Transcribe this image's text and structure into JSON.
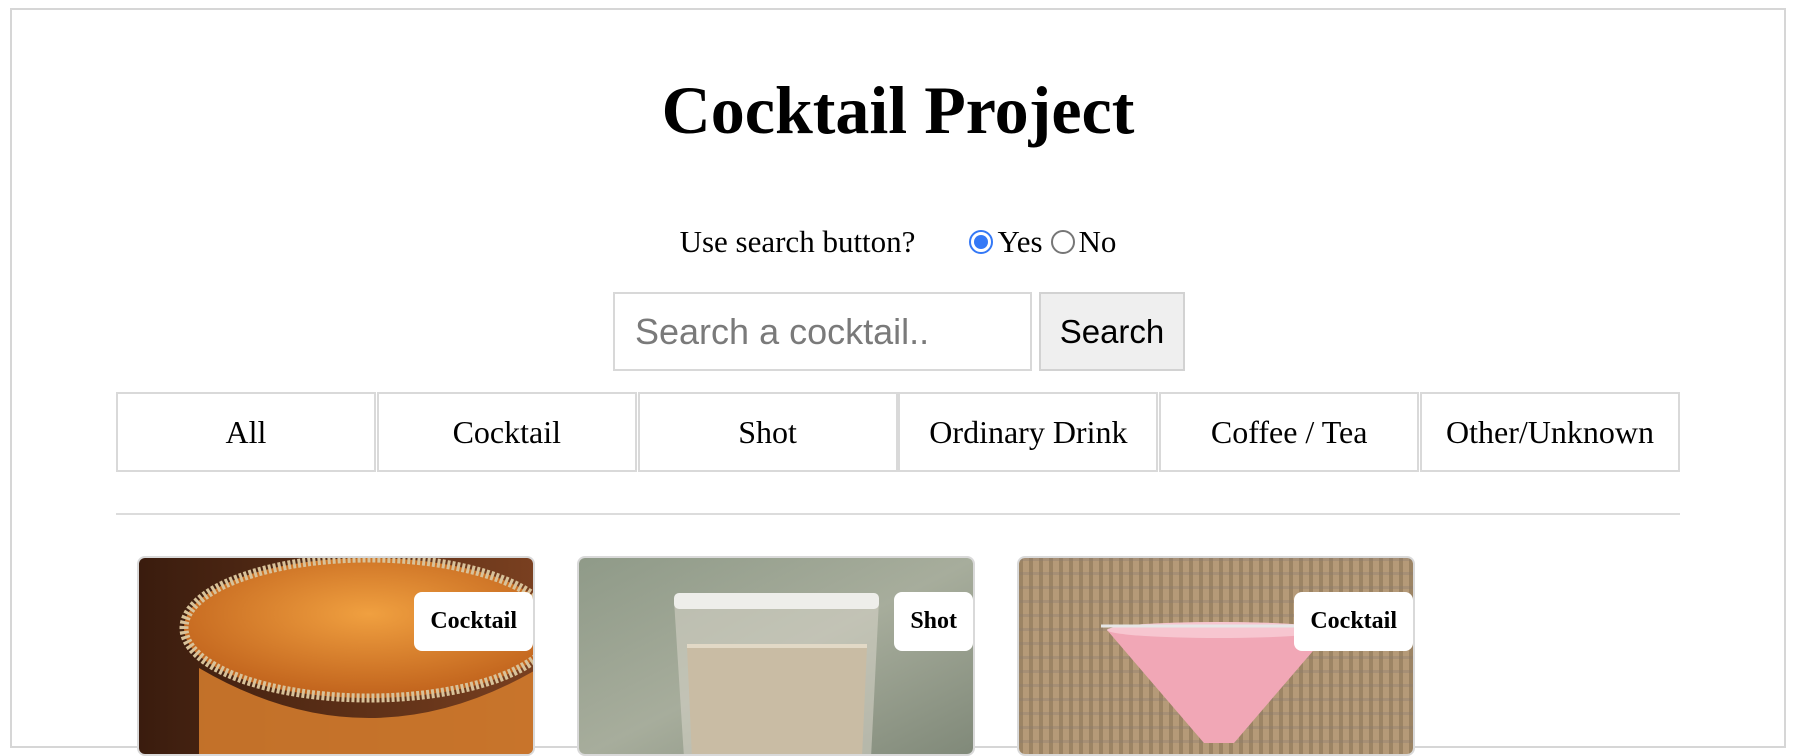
{
  "header": {
    "title": "Cocktail Project"
  },
  "search_mode": {
    "question": "Use search button?",
    "options": [
      {
        "label": "Yes",
        "checked": true
      },
      {
        "label": "No",
        "checked": false
      }
    ]
  },
  "search": {
    "placeholder": "Search a cocktail..",
    "value": "",
    "clear_icon": "close-icon",
    "button_label": "Search"
  },
  "categories": [
    "All",
    "Cocktail",
    "Shot",
    "Ordinary Drink",
    "Coffee / Tea",
    "Other/Unknown"
  ],
  "cards": [
    {
      "badge": "Cocktail"
    },
    {
      "badge": "Shot"
    },
    {
      "badge": "Cocktail"
    }
  ],
  "colors": {
    "radio_accent": "#3478f6",
    "button_bg": "#efefef",
    "border": "#d9d9d9"
  }
}
